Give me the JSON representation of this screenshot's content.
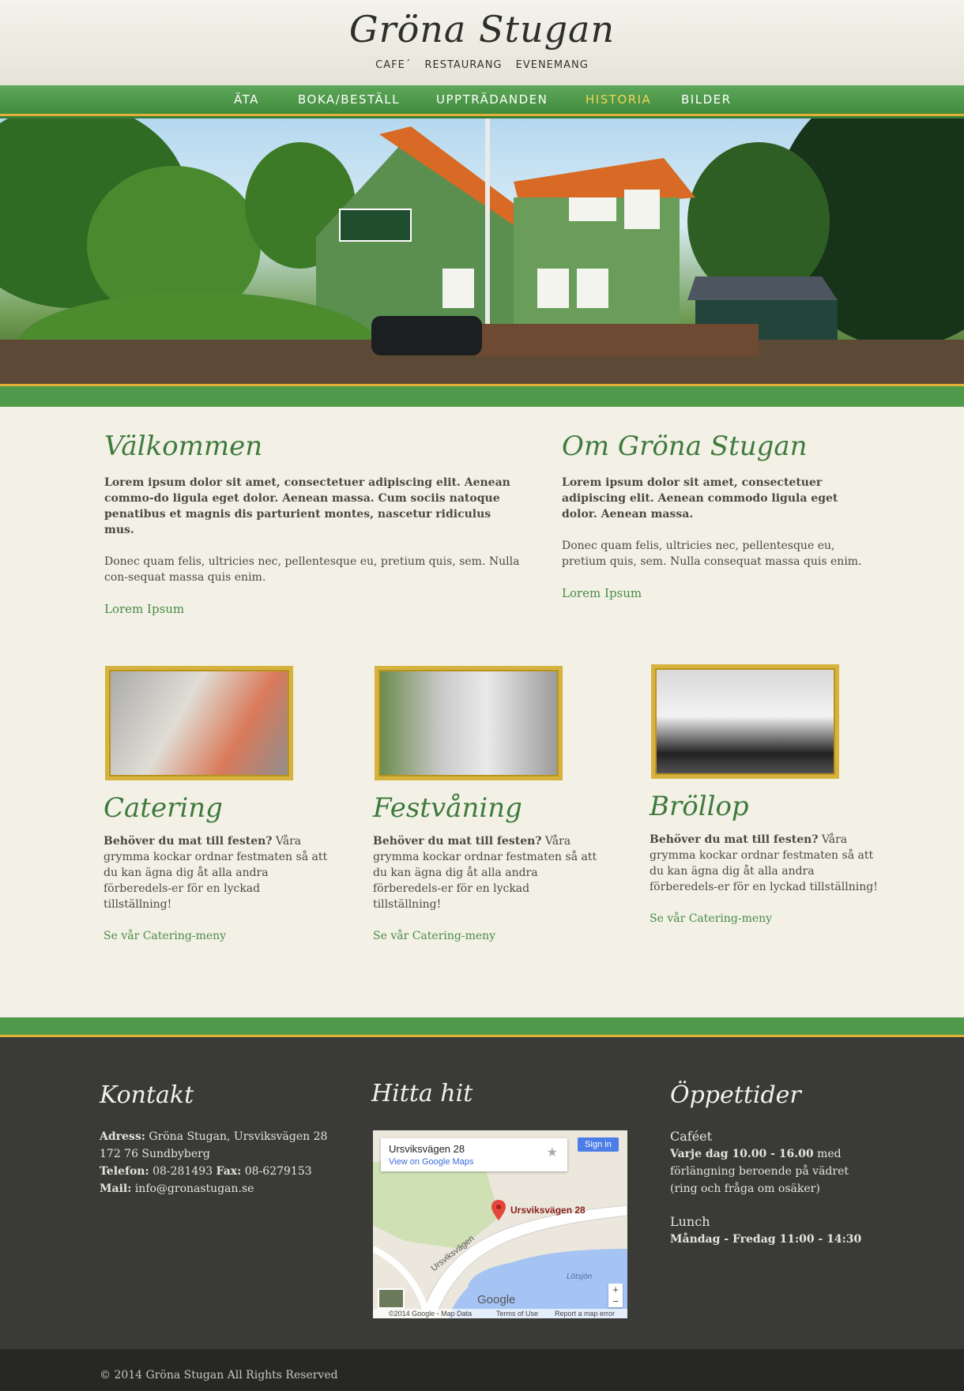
{
  "site": {
    "logo_title": "Gröna Stugan",
    "logo_subtitle": "CAFE´ RESTAURANG EVENEMANG"
  },
  "nav": {
    "items": [
      {
        "label": "ÄTA"
      },
      {
        "label": "BOKA/BESTÄLL"
      },
      {
        "label": "UPPTRÄDANDEN"
      },
      {
        "label": "HISTORIA",
        "active": true
      },
      {
        "label": "BILDER"
      }
    ],
    "active_color": "#f1d357"
  },
  "intro": {
    "left": {
      "title": "Välkommen",
      "lead": "Lorem ipsum dolor sit amet, consectetuer adipiscing elit. Aenean commo-do ligula eget dolor. Aenean massa. Cum sociis natoque penatibus et magnis dis parturient montes, nascetur ridiculus mus.",
      "body": "Donec quam felis, ultricies nec, pellentesque eu, pretium quis, sem. Nulla con-sequat massa quis enim.",
      "link": "Lorem Ipsum"
    },
    "right": {
      "title": "Om Gröna Stugan",
      "lead": "Lorem ipsum dolor sit amet, consectetuer adipiscing elit. Aenean commodo ligula eget dolor. Aenean massa.",
      "body": "Donec quam felis, ultricies nec, pellentesque eu, pretium quis, sem. Nulla consequat massa quis enim.",
      "link": "Lorem Ipsum"
    }
  },
  "cards": [
    {
      "title": "Catering",
      "lead": "Behöver du mat till festen?",
      "body": " Våra grymma kockar ordnar festmaten så att du kan ägna dig åt alla andra förberedels-er för en lyckad tillställning!",
      "link": "Se vår Catering-meny"
    },
    {
      "title": "Festvåning",
      "lead": "Behöver du mat till festen?",
      "body": " Våra grymma kockar ordnar festmaten så att du kan ägna dig åt alla andra förberedels-er för en lyckad tillställning!",
      "link": "Se vår Catering-meny"
    },
    {
      "title": "Bröllop",
      "lead": "Behöver du mat till festen?",
      "body": " Våra grymma kockar ordnar festmaten så att du kan ägna dig åt alla andra förberedels-er för en lyckad tillställning!",
      "link": "Se vår Catering-meny"
    }
  ],
  "footer": {
    "contact": {
      "title": "Kontakt",
      "address_label": "Adress:",
      "address": " Gröna Stugan, Ursviksvägen 28",
      "city": "172 76 Sundbyberg",
      "phone_label": "Telefon:",
      "phone": " 08-281493 ",
      "fax_label": "Fax:",
      "fax": " 08-6279153",
      "mail_label": "Mail:",
      "mail": " info@gronastugan.se"
    },
    "map": {
      "title": "Hitta hit",
      "place": "Ursviksvägen 28",
      "view_link": "View on Google Maps",
      "sign_in": "Sign in",
      "marker_label": "Ursviksvägen 28",
      "road_label": "Ursviksvägen",
      "lake_label": "Lötsjön",
      "brand": "Google",
      "copyright": "©2014 Google - Map Data",
      "terms": "Terms of Use",
      "report": "Report a map error",
      "zoom_in": "+",
      "zoom_out": "−"
    },
    "hours": {
      "title": "Öppettider",
      "cafe_heading": "Caféet",
      "cafe_bold": "Varje dag 10.00 - 16.00",
      "cafe_rest": " med förlängning beroende på vädret (ring och fråga om osäker)",
      "lunch_heading": "Lunch",
      "lunch_bold": "Måndag - Fredag 11:00 - 14:30"
    }
  },
  "copyright": "© 2014 Gröna Stugan All Rights Reserved"
}
